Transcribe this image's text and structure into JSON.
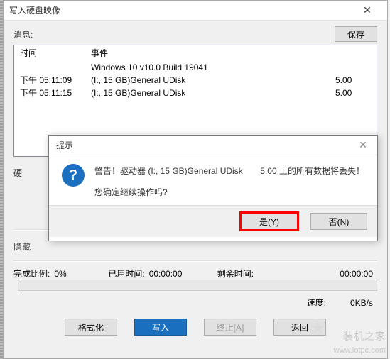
{
  "window": {
    "title": "写入硬盘映像",
    "close_glyph": "✕"
  },
  "msg": {
    "label": "消息:",
    "save_label": "保存"
  },
  "log": {
    "headers": {
      "time": "时间",
      "event": "事件"
    },
    "line0": "Windows 10 v10.0 Build 19041",
    "rows": [
      {
        "time": "下午 05:11:09",
        "event": "(I:, 15 GB)General UDisk",
        "val": "5.00"
      },
      {
        "time": "下午 05:11:15",
        "event": "(I:, 15 GB)General UDisk",
        "val": "5.00"
      }
    ]
  },
  "form": {
    "drive_label": "硬",
    "hidden_label": "隐藏"
  },
  "progress": {
    "ratio_label": "完成比例:",
    "ratio_value": "0%",
    "elapsed_label": "已用时间:",
    "elapsed_value": "00:00:00",
    "remain_label": "剩余时间:",
    "remain_value": "00:00:00",
    "speed_label": "速度:",
    "speed_value": "0KB/s"
  },
  "buttons": {
    "format": "格式化",
    "write": "写入",
    "stop": "终止[A]",
    "back": "返回"
  },
  "modal": {
    "title": "提示",
    "close_glyph": "✕",
    "icon": "?",
    "warn_a": "警告！驱动器 (I:, 15 GB)General UDisk",
    "warn_b": "5.00 上的所有数据将丢失！",
    "confirm": "您确定继续操作吗?",
    "yes": "是(Y)",
    "no": "否(N)"
  },
  "watermark": {
    "brand": "装机之家",
    "url": "www.lotpc.com",
    "star": "★"
  }
}
